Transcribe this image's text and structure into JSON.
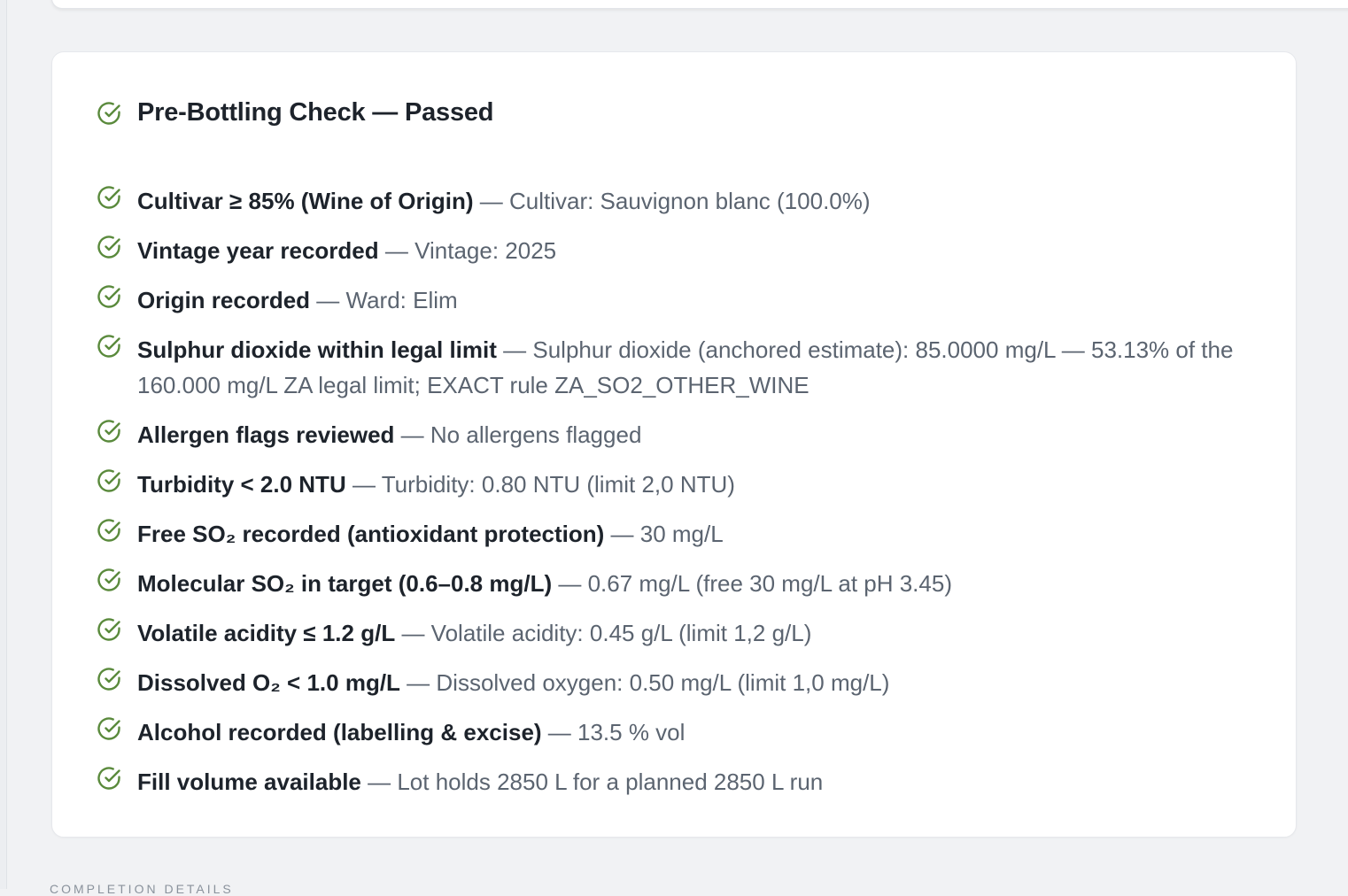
{
  "card": {
    "title": "Pre-Bottling Check — Passed",
    "status_icon": "check-circle-icon",
    "accent_color": "#5a8a3c"
  },
  "separator": " — ",
  "checks": [
    {
      "label": "Cultivar ≥ 85% (Wine of Origin)",
      "detail": "Cultivar: Sauvignon blanc (100.0%)"
    },
    {
      "label": "Vintage year recorded",
      "detail": "Vintage: 2025"
    },
    {
      "label": "Origin recorded",
      "detail": "Ward: Elim"
    },
    {
      "label": "Sulphur dioxide within legal limit",
      "detail": "Sulphur dioxide (anchored estimate): 85.0000 mg/L — 53.13% of the 160.000 mg/L ZA legal limit; EXACT rule ZA_SO2_OTHER_WINE"
    },
    {
      "label": "Allergen flags reviewed",
      "detail": "No allergens flagged"
    },
    {
      "label": "Turbidity < 2.0 NTU",
      "detail": "Turbidity: 0.80 NTU (limit 2,0 NTU)"
    },
    {
      "label": "Free SO₂ recorded (antioxidant protection)",
      "detail": "30 mg/L"
    },
    {
      "label": "Molecular SO₂ in target (0.6–0.8 mg/L)",
      "detail": "0.67 mg/L (free 30 mg/L at pH 3.45)"
    },
    {
      "label": "Volatile acidity ≤ 1.2 g/L",
      "detail": "Volatile acidity: 0.45 g/L (limit 1,2 g/L)"
    },
    {
      "label": "Dissolved O₂ < 1.0 mg/L",
      "detail": "Dissolved oxygen: 0.50 mg/L (limit 1,0 mg/L)"
    },
    {
      "label": "Alcohol recorded (labelling & excise)",
      "detail": "13.5 % vol"
    },
    {
      "label": "Fill volume available",
      "detail": "Lot holds 2850 L for a planned 2850 L run"
    }
  ],
  "next_section": {
    "label": "COMPLETION DETAILS"
  }
}
